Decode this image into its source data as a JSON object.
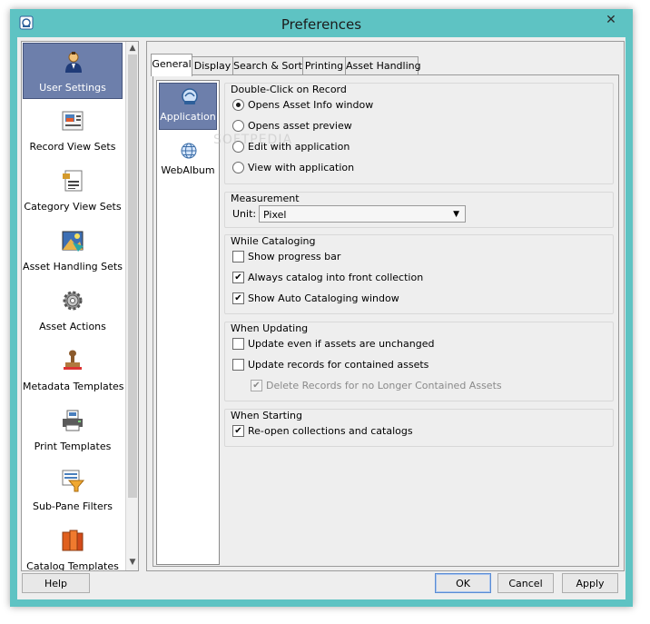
{
  "window": {
    "title": "Preferences",
    "close_symbol": "✕"
  },
  "sidebar": {
    "items": [
      {
        "label": "User Settings",
        "icon": "user-icon",
        "selected": true
      },
      {
        "label": "Record View Sets",
        "icon": "record-view-icon"
      },
      {
        "label": "Category View Sets",
        "icon": "category-view-icon"
      },
      {
        "label": "Asset Handling Sets",
        "icon": "asset-handling-icon"
      },
      {
        "label": "Asset Actions",
        "icon": "gear-icon"
      },
      {
        "label": "Metadata Templates",
        "icon": "stamp-icon"
      },
      {
        "label": "Print Templates",
        "icon": "printer-icon"
      },
      {
        "label": "Sub-Pane Filters",
        "icon": "filter-icon"
      },
      {
        "label": "Catalog Templates",
        "icon": "catalog-books-icon"
      }
    ],
    "scroll_up": "▲",
    "scroll_down": "▼"
  },
  "tabs": [
    {
      "label": "General",
      "active": true
    },
    {
      "label": "Display"
    },
    {
      "label": "Search & Sort"
    },
    {
      "label": "Printing"
    },
    {
      "label": "Asset Handling"
    }
  ],
  "subpanel": {
    "items": [
      {
        "label": "Application",
        "icon": "application-icon",
        "selected": true
      },
      {
        "label": "WebAlbum",
        "icon": "globe-icon"
      }
    ]
  },
  "groups": {
    "double_click": {
      "title": "Double-Click on Record",
      "options": [
        {
          "label": "Opens Asset Info window",
          "checked": true
        },
        {
          "label": "Opens asset preview",
          "checked": false
        },
        {
          "label": "Edit with application",
          "checked": false
        },
        {
          "label": "View with application",
          "checked": false
        }
      ]
    },
    "measurement": {
      "title": "Measurement",
      "unit_label": "Unit:",
      "unit_value": "Pixel"
    },
    "cataloging": {
      "title": "While Cataloging",
      "options": [
        {
          "label": "Show progress bar",
          "checked": false
        },
        {
          "label": "Always catalog into front collection",
          "checked": true
        },
        {
          "label": "Show Auto Cataloging window",
          "checked": true
        }
      ]
    },
    "updating": {
      "title": "When Updating",
      "options": [
        {
          "label": "Update even if assets are unchanged",
          "checked": false
        },
        {
          "label": "Update records for contained assets",
          "checked": false
        },
        {
          "label": "Delete Records for no Longer Contained Assets",
          "checked": true,
          "disabled": true
        }
      ]
    },
    "starting": {
      "title": "When Starting",
      "options": [
        {
          "label": "Re-open collections and catalogs",
          "checked": true
        }
      ]
    }
  },
  "watermark": "SOFTPEDIA",
  "buttons": {
    "help": "Help",
    "ok": "OK",
    "cancel": "Cancel",
    "apply": "Apply"
  },
  "check_mark": "✔"
}
